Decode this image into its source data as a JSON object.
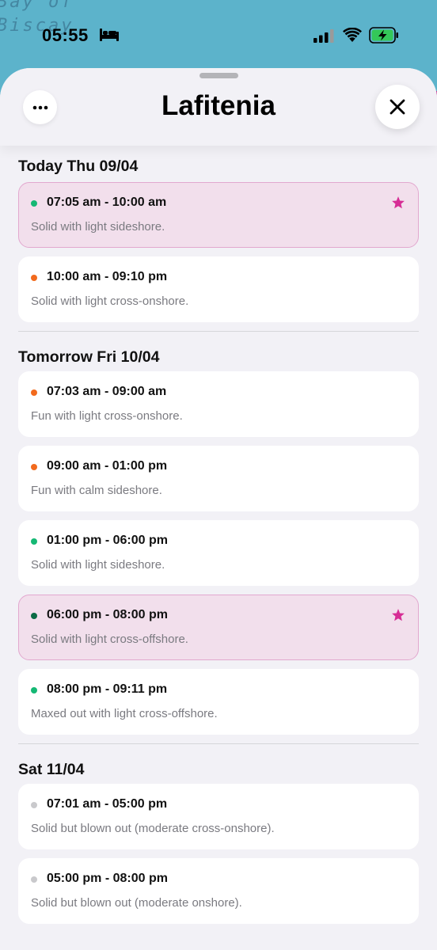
{
  "map": {
    "label_line1": "Bay of",
    "label_line2": "Biscay"
  },
  "status_bar": {
    "time": "05:55",
    "focus_icon": "bed-icon",
    "signal_icon": "cellular-signal-icon",
    "wifi_icon": "wifi-icon",
    "battery_icon": "battery-charging-icon",
    "battery_color": "#34c759"
  },
  "header": {
    "title": "Lafitenia",
    "more_icon": "ellipsis-icon",
    "close_icon": "close-icon"
  },
  "colors": {
    "green": "#15b874",
    "orange": "#f26a1d",
    "dark_green": "#0c6b45",
    "gray": "#c9c9cc",
    "star": "#d62d95",
    "highlight_bg": "#f2dfec"
  },
  "days": [
    {
      "title": "Today Thu 09/04",
      "slots": [
        {
          "time": "07:05 am - 10:00 am",
          "desc": "Solid with light sideshore.",
          "dot": "#15b874",
          "highlight": true,
          "starred": true
        },
        {
          "time": "10:00 am - 09:10 pm",
          "desc": "Solid with light cross-onshore.",
          "dot": "#f26a1d",
          "highlight": false,
          "starred": false
        }
      ]
    },
    {
      "title": "Tomorrow Fri 10/04",
      "slots": [
        {
          "time": "07:03 am - 09:00 am",
          "desc": "Fun with light cross-onshore.",
          "dot": "#f26a1d",
          "highlight": false,
          "starred": false
        },
        {
          "time": "09:00 am - 01:00 pm",
          "desc": "Fun with calm sideshore.",
          "dot": "#f26a1d",
          "highlight": false,
          "starred": false
        },
        {
          "time": "01:00 pm - 06:00 pm",
          "desc": "Solid with light sideshore.",
          "dot": "#15b874",
          "highlight": false,
          "starred": false
        },
        {
          "time": "06:00 pm - 08:00 pm",
          "desc": "Solid with light cross-offshore.",
          "dot": "#0c6b45",
          "highlight": true,
          "starred": true
        },
        {
          "time": "08:00 pm - 09:11 pm",
          "desc": "Maxed out with light cross-offshore.",
          "dot": "#15b874",
          "highlight": false,
          "starred": false
        }
      ]
    },
    {
      "title": "Sat 11/04",
      "slots": [
        {
          "time": "07:01 am - 05:00 pm",
          "desc": "Solid but blown out (moderate cross-onshore).",
          "dot": "#c9c9cc",
          "highlight": false,
          "starred": false
        },
        {
          "time": "05:00 pm - 08:00 pm",
          "desc": "Solid but blown out (moderate onshore).",
          "dot": "#c9c9cc",
          "highlight": false,
          "starred": false
        }
      ]
    }
  ]
}
